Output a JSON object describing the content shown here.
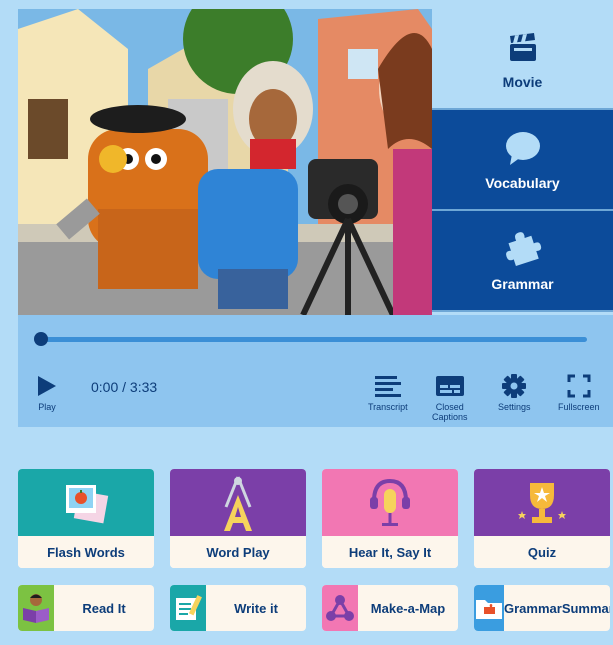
{
  "side_tabs": [
    {
      "label": "Movie",
      "icon": "clapperboard-icon"
    },
    {
      "label": "Vocabulary",
      "icon": "speech-bubble-icon"
    },
    {
      "label": "Grammar",
      "icon": "puzzle-icon"
    }
  ],
  "player": {
    "time": "0:00 / 3:33",
    "progress": 0.0,
    "play_label": "Play",
    "transcript_label": "Transcript",
    "cc_label_line1": "Closed",
    "cc_label_line2": "Captions",
    "settings_label": "Settings",
    "fullscreen_label": "Fullscreen"
  },
  "activities": [
    {
      "label": "Flash Words",
      "color": "#1aa7a8",
      "icon": "flash-cards-icon"
    },
    {
      "label": "Word Play",
      "color": "#7b3fa8",
      "icon": "word-play-icon"
    },
    {
      "label": "Hear It, Say It",
      "color": "#f277b3",
      "icon": "microphone-icon"
    },
    {
      "label": "Quiz",
      "color": "#7b3fa8",
      "icon": "trophy-icon"
    }
  ],
  "small_activities": [
    {
      "label": "Read It",
      "color": "#7cc242",
      "icon": "reading-icon"
    },
    {
      "label": "Write it",
      "color": "#1aa7a8",
      "icon": "notepad-icon"
    },
    {
      "label": "Make-a-Map",
      "color": "#f277b3",
      "icon": "concept-map-icon"
    },
    {
      "label_line1": "Grammar",
      "label_line2": "Summary",
      "color": "#3a9de0",
      "icon": "folder-icon"
    }
  ]
}
